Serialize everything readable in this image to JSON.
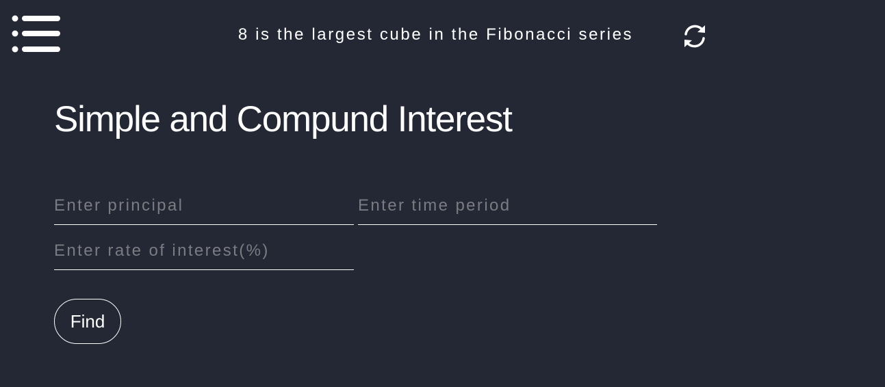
{
  "header": {
    "menu_icon": "hamburger-list-icon",
    "fact": "8 is the largest cube in the Fibonacci series",
    "refresh_icon": "refresh-arrows-icon"
  },
  "main": {
    "title": "Simple and Compund Interest",
    "fields": {
      "principal": {
        "placeholder": "Enter principal",
        "value": ""
      },
      "time_period": {
        "placeholder": "Enter time period",
        "value": ""
      },
      "rate": {
        "placeholder": "Enter rate of interest(%)",
        "value": ""
      }
    },
    "find_label": "Find"
  },
  "colors": {
    "background": "#232834",
    "text": "#ffffff",
    "placeholder": "#7a7c82"
  }
}
